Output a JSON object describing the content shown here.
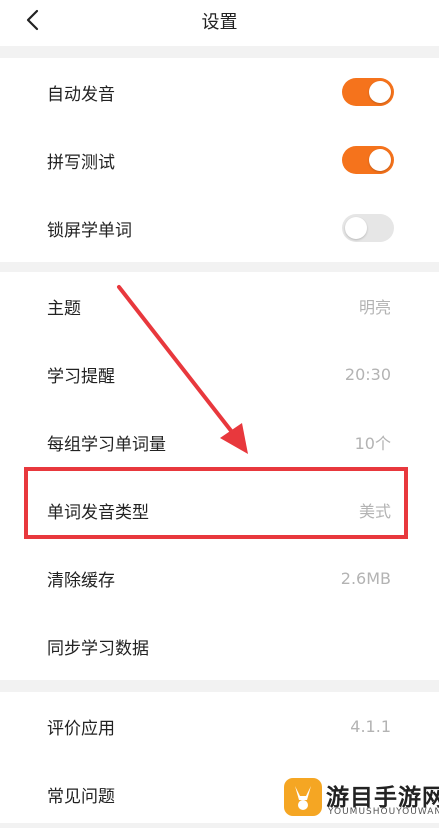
{
  "header": {
    "title": "设置",
    "back_icon": "chevron-left-icon"
  },
  "toggles": [
    {
      "label": "自动发音",
      "on": true
    },
    {
      "label": "拼写测试",
      "on": true
    },
    {
      "label": "锁屏学单词",
      "on": false
    }
  ],
  "settings": [
    {
      "label": "主题",
      "value": "明亮"
    },
    {
      "label": "学习提醒",
      "value": "20:30"
    },
    {
      "label": "每组学习单词量",
      "value": "10个"
    },
    {
      "label": "单词发音类型",
      "value": "美式"
    },
    {
      "label": "清除缓存",
      "value": "2.6MB"
    },
    {
      "label": "同步学习数据",
      "value": ""
    }
  ],
  "about": [
    {
      "label": "评价应用",
      "value": "4.1.1"
    },
    {
      "label": "常见问题",
      "value": ""
    }
  ],
  "annotation": {
    "color": "#e8383d",
    "highlighted_item": "单词发音类型"
  },
  "accent_color": "#f5731c",
  "watermark": {
    "text": "游目手游网",
    "subtext": "YOUMUSHOUYOUWANG"
  }
}
